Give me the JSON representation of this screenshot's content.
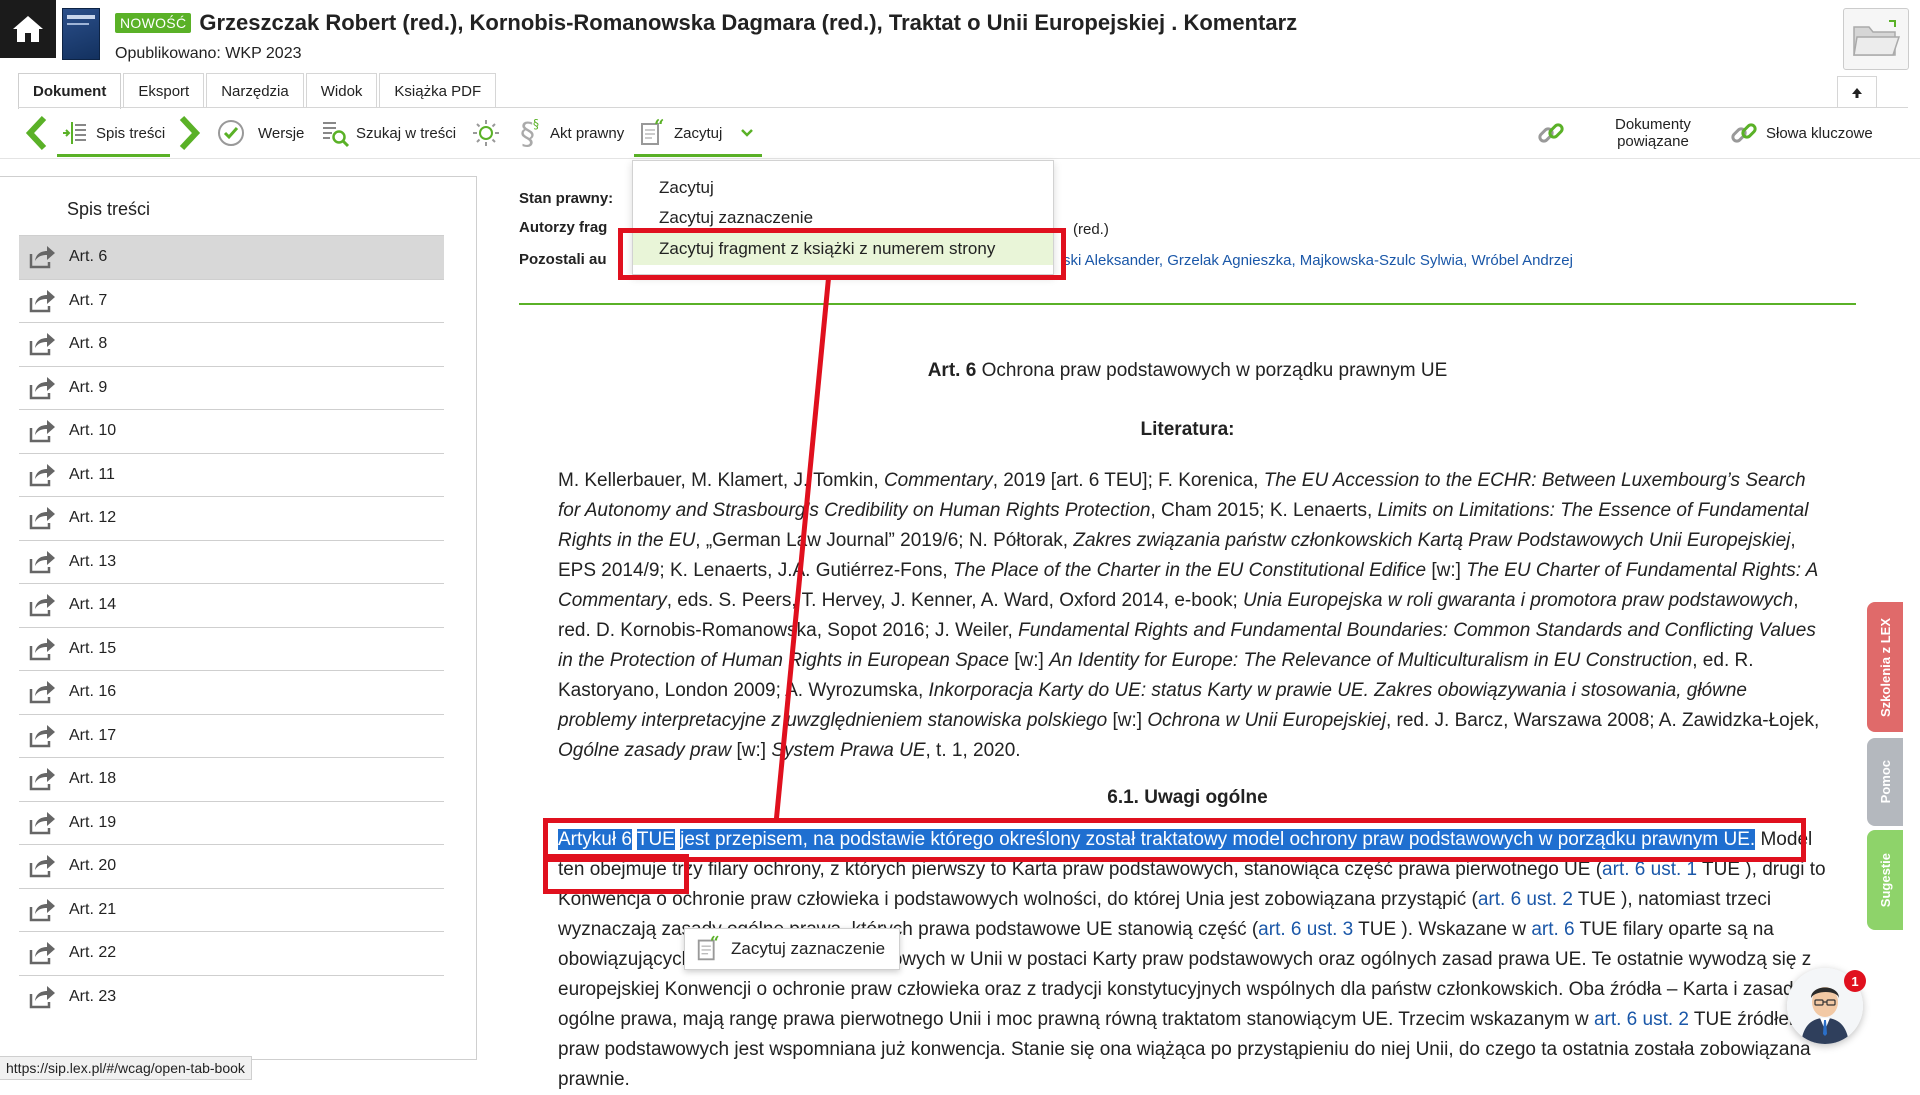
{
  "header": {
    "badge": "NOWOŚĆ",
    "title": "Grzeszczak Robert (red.), Kornobis-Romanowska Dagmara (red.),  Traktat o Unii Europejskiej . Komentarz",
    "published": "Opublikowano: WKP 2023"
  },
  "tabs": [
    {
      "label": "Dokument"
    },
    {
      "label": "Eksport"
    },
    {
      "label": "Narzędzia"
    },
    {
      "label": "Widok"
    },
    {
      "label": "Książka PDF"
    }
  ],
  "toolbar": {
    "toc": "Spis treści",
    "versions": "Wersje",
    "search": "Szukaj w treści",
    "legal_act": "Akt prawny",
    "quote": "Zacytuj",
    "related_docs_line1": "Dokumenty",
    "related_docs_line2": "powiązane",
    "keywords": "Słowa kluczowe"
  },
  "dropdown": {
    "items": [
      "Zacytuj",
      "Zacytuj zaznaczenie",
      "Zacytuj fragment z książki z numerem strony"
    ]
  },
  "sidebar": {
    "title": "Spis treści",
    "items": [
      "Art. 6",
      "Art. 7",
      "Art. 8",
      "Art. 9",
      "Art. 10",
      "Art. 11",
      "Art. 12",
      "Art. 13",
      "Art. 14",
      "Art. 15",
      "Art. 16",
      "Art. 17",
      "Art. 18",
      "Art. 19",
      "Art. 20",
      "Art. 21",
      "Art. 22",
      "Art. 23"
    ]
  },
  "meta": {
    "status_label": "Stan prawny:",
    "authors_label": "Autorzy frag",
    "authors_value": "(red.)",
    "others_label": "Pozostali au",
    "others_value": "ski Aleksander, Grzelak Agnieszka, Majkowska-Szulc Sylwia, Wróbel Andrzej"
  },
  "article": {
    "num": "Art. 6",
    "title": "Ochrona praw podstawowych w porządku prawnym UE",
    "lit_heading": "Literatura:",
    "section_heading": "6.1. Uwagi ogólne"
  },
  "literature": [
    {
      "t": "M. Kellerbauer, M. Klamert, J. Tomkin, "
    },
    {
      "t": "Commentary",
      "i": true
    },
    {
      "t": ", 2019 [art. 6 TEU]; F. Korenica, "
    },
    {
      "t": "The EU Accession to the ECHR: Between Luxembourg’s Search for Autonomy and Strasbourg’s Credibility on Human Rights Protection",
      "i": true
    },
    {
      "t": ", Cham 2015; K. Lenaerts, "
    },
    {
      "t": "Limits on Limitations: The Essence of Fundamental Rights in the EU",
      "i": true
    },
    {
      "t": ", „German Law Journal” 2019/6; N. Półtorak, "
    },
    {
      "t": "Zakres związania państw członkowskich Kartą Praw Podstawowych Unii Europejskiej",
      "i": true
    },
    {
      "t": ", EPS 2014/9; K. Lenaerts, J.A. Gutiérrez-Fons, "
    },
    {
      "t": "The Place of the Charter in the EU Constitutional Edifice",
      "i": true
    },
    {
      "t": " [w:] "
    },
    {
      "t": "The EU Charter of Fundamental Rights: A Commentary",
      "i": true
    },
    {
      "t": ", eds. S. Peers, T. Hervey, J. Kenner, A. Ward, Oxford 2014, e-book; "
    },
    {
      "t": "Unia Europejska w roli gwaranta i promotora praw podstawowych",
      "i": true
    },
    {
      "t": ", red. D. Kornobis-Romanowska, Sopot 2016; J. Weiler, "
    },
    {
      "t": "Fundamental Rights and Fundamental Boundaries: Common Standards and Conflicting Values in the Protection of Human Rights in European Space",
      "i": true
    },
    {
      "t": " [w:] "
    },
    {
      "t": "An Identity for Europe: The Relevance of Multiculturalism in EU Construction",
      "i": true
    },
    {
      "t": ", ed. R. Kastoryano, London 2009; A. Wyrozumska, "
    },
    {
      "t": "Inkorporacja Karty do UE: status Karty w prawie UE. Zakres obowiązywania i stosowania, główne problemy interpretacyjne z uwzględnieniem stanowiska polskiego",
      "i": true
    },
    {
      "t": " [w:] "
    },
    {
      "t": "Ochrona w Unii Europejskiej",
      "i": true
    },
    {
      "t": ", red. J. Barcz, Warszawa 2008; A. Zawidzka-Łojek, "
    },
    {
      "t": "Ogólne zasady praw",
      "i": true
    },
    {
      "t": " [w:] "
    },
    {
      "t": "System Prawa UE",
      "i": true
    },
    {
      "t": ", t. 1, 2020."
    }
  ],
  "body": [
    {
      "t": "Artykuł 6",
      "h": true
    },
    {
      "t": " "
    },
    {
      "t": "TUE",
      "h": true
    },
    {
      "t": " "
    },
    {
      "t": "jest przepisem, na podstawie którego określony został traktatowy model ochrony praw podstawowych w porządku prawnym UE.",
      "h": true
    },
    {
      "t": " Model ten obejmuje trzy filary ochrony, z których pierwszy to Karta praw podstawowych, stanowiąca część prawa pierwotnego UE ("
    },
    {
      "t": "art. 6 ust. 1",
      "l": true
    },
    {
      "t": "  TUE ), drugi to Konwencja o ochronie praw człowieka i podstawowych wolności, do której Unia jest zobowiązana przystąpić ("
    },
    {
      "t": "art. 6 ust. 2",
      "l": true
    },
    {
      "t": "  TUE ), natomiast trzeci wyznaczają zasady ogólne prawa, których prawa podstawowe UE stanowią część ("
    },
    {
      "t": "art. 6 ust. 3",
      "l": true
    },
    {
      "t": "  TUE ). Wskazane w "
    },
    {
      "t": "art. 6",
      "l": true
    },
    {
      "t": "  TUE  filary oparte są na obowiązujących źródłach praw podstawowych w Unii w postaci Karty praw podstawowych oraz ogólnych zasad prawa UE. Te ostatnie wywodzą się z europejskiej Konwencji o ochronie praw człowieka oraz z tradycji konstytucyjnych wspólnych dla państw członkowskich. Oba źródła – Karta i zasady ogólne prawa, mają rangę prawa pierwotnego Unii i moc prawną równą traktatom stanowiącym UE. Trzecim wskazanym w "
    },
    {
      "t": "art. 6 ust. 2",
      "l": true
    },
    {
      "t": "  TUE  źródłem praw podstawowych jest wspomniana już konwencja. Stanie się ona wiążąca po przystąpieniu do niej Unii, do czego ta ostatnia została zobowiązana prawnie."
    }
  ],
  "tooltip": {
    "label": "Zacytuj zaznaczenie"
  },
  "side_tabs": [
    "Szkolenia z LEX",
    "Pomoc",
    "Sugestie"
  ],
  "notification_count": "1",
  "status_url": "https://sip.lex.pl/#/wcag/open-tab-book",
  "colors": {
    "accent": "#5ab127",
    "link": "#1a57a8",
    "highlight": "#1f6fd0",
    "annotation": "#e0101e"
  }
}
